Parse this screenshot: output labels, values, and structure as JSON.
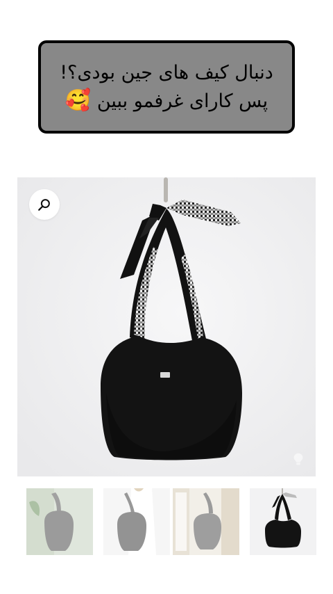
{
  "caption": {
    "line1": "دنبال کیف های جین بودی؟!",
    "line2": "پس کارای غرفمو ببین",
    "emoji": "🥰"
  },
  "gallery": {
    "zoom_icon": "search-icon",
    "main_image": "black-hobo-bag-with-checkered-scarf-handle",
    "thumbnails": [
      {
        "name": "thumb-grey-bag-plant",
        "active": false
      },
      {
        "name": "thumb-grey-bag-model",
        "active": false
      },
      {
        "name": "thumb-grey-bag-window",
        "active": false
      },
      {
        "name": "thumb-black-bag",
        "active": true
      }
    ]
  },
  "colors": {
    "caption_bg": "#888888",
    "caption_border": "#000000",
    "bag": "#131313",
    "photo_bg": "#f2f2f3"
  }
}
